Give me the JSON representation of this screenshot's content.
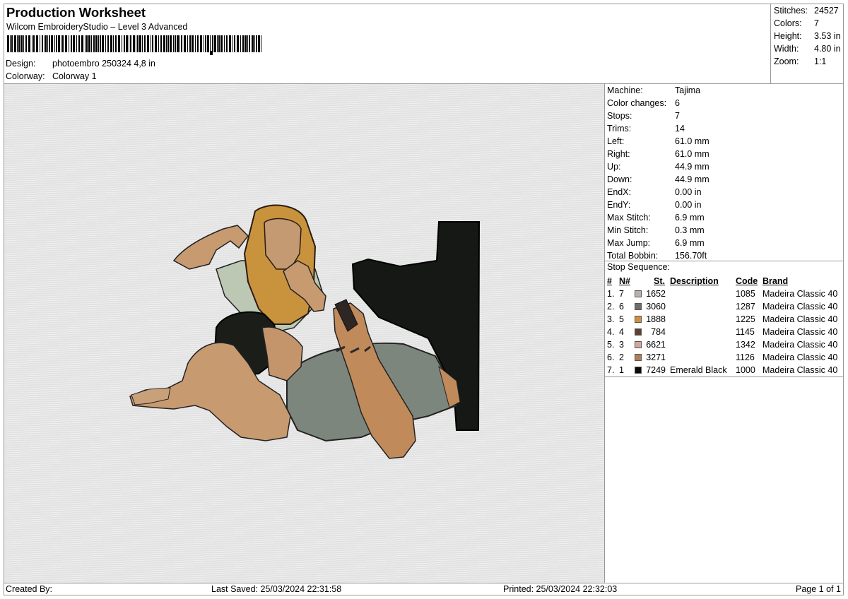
{
  "header": {
    "title": "Production Worksheet",
    "subtitle": "Wilcom EmbroideryStudio – Level 3 Advanced",
    "design_label": "Design:",
    "design_value": "photoembro 250324 4,8 in",
    "colorway_label": "Colorway:",
    "colorway_value": "Colorway 1"
  },
  "stats": [
    {
      "label": "Stitches:",
      "value": "24527"
    },
    {
      "label": "Colors:",
      "value": "7"
    },
    {
      "label": "Height:",
      "value": "3.53 in"
    },
    {
      "label": "Width:",
      "value": "4.80 in"
    },
    {
      "label": "Zoom:",
      "value": "1:1"
    }
  ],
  "machine": [
    {
      "label": "Machine:",
      "value": "Tajima"
    },
    {
      "label": "Color changes:",
      "value": "6"
    },
    {
      "label": "Stops:",
      "value": "7"
    },
    {
      "label": "Trims:",
      "value": "14"
    },
    {
      "label": "Left:",
      "value": "61.0 mm"
    },
    {
      "label": "Right:",
      "value": "61.0 mm"
    },
    {
      "label": "Up:",
      "value": "44.9 mm"
    },
    {
      "label": "Down:",
      "value": "44.9 mm"
    },
    {
      "label": "EndX:",
      "value": "0.00 in"
    },
    {
      "label": "EndY:",
      "value": "0.00 in"
    },
    {
      "label": "Max Stitch:",
      "value": "6.9 mm"
    },
    {
      "label": "Min Stitch:",
      "value": "0.3 mm"
    },
    {
      "label": "Max Jump:",
      "value": "6.9 mm"
    },
    {
      "label": "Total Bobbin:",
      "value": "156.70ft"
    }
  ],
  "stop_sequence": {
    "title": "Stop Sequence:",
    "headers": {
      "idx": "#",
      "n": "N#",
      "st": "St.",
      "desc": "Description",
      "code": "Code",
      "brand": "Brand"
    },
    "rows": [
      {
        "idx": "1.",
        "n": "7",
        "color": "#b8b2aa",
        "st": "1652",
        "desc": "",
        "code": "1085",
        "brand": "Madeira Classic 40"
      },
      {
        "idx": "2.",
        "n": "6",
        "color": "#6f6d69",
        "st": "3060",
        "desc": "",
        "code": "1287",
        "brand": "Madeira Classic 40"
      },
      {
        "idx": "3.",
        "n": "5",
        "color": "#d0913d",
        "st": "1888",
        "desc": "",
        "code": "1225",
        "brand": "Madeira Classic 40"
      },
      {
        "idx": "4.",
        "n": "4",
        "color": "#5e4030",
        "st": "784",
        "desc": "",
        "code": "1145",
        "brand": "Madeira Classic 40"
      },
      {
        "idx": "5.",
        "n": "3",
        "color": "#d4a89a",
        "st": "6621",
        "desc": "",
        "code": "1342",
        "brand": "Madeira Classic 40"
      },
      {
        "idx": "6.",
        "n": "2",
        "color": "#b07e58",
        "st": "3271",
        "desc": "",
        "code": "1126",
        "brand": "Madeira Classic 40"
      },
      {
        "idx": "7.",
        "n": "1",
        "color": "#0a0a0a",
        "st": "7249",
        "desc": "Emerald Black",
        "code": "1000",
        "brand": "Madeira Classic 40"
      }
    ]
  },
  "footer": {
    "created_by": "Created By:",
    "last_saved": "Last Saved: 25/03/2024 22:31:58",
    "printed": "Printed: 25/03/2024 22:32:03",
    "page": "Page 1 of 1"
  }
}
